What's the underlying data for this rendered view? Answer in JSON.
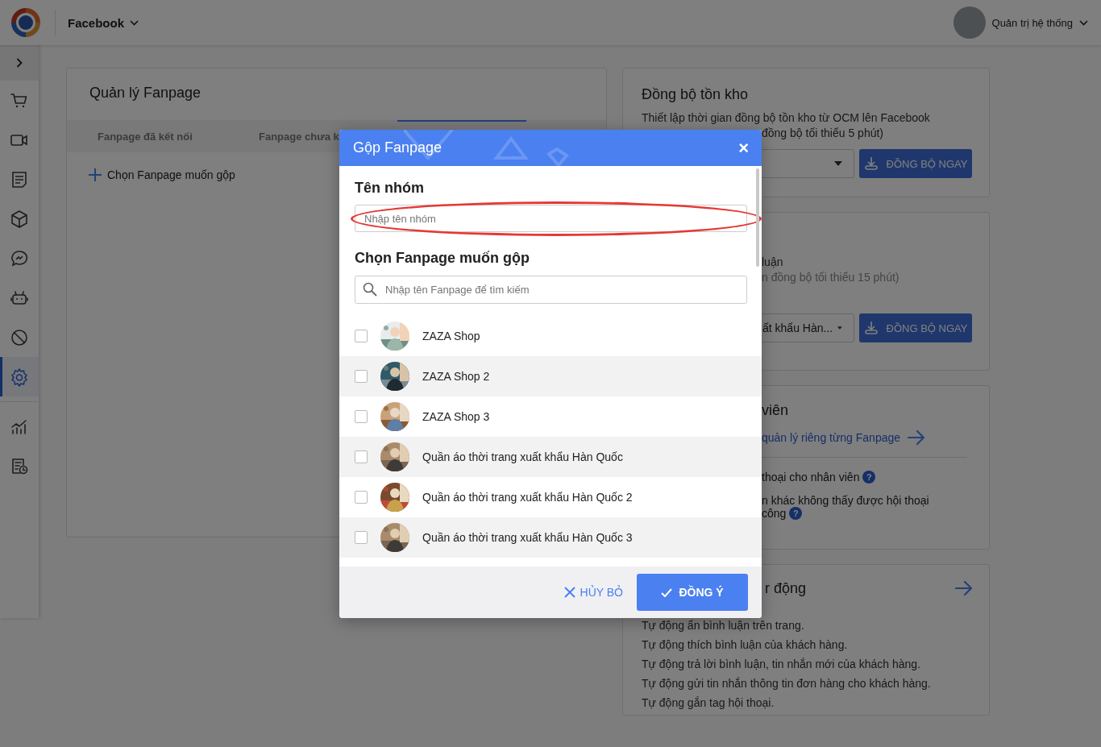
{
  "header": {
    "app": "Facebook",
    "user": "Quản trị hệ thống"
  },
  "sidebar": {
    "items": [
      {
        "kind": "cart",
        "selected": false
      },
      {
        "kind": "video",
        "selected": false
      },
      {
        "kind": "document",
        "selected": false
      },
      {
        "kind": "box",
        "selected": false
      },
      {
        "kind": "chat",
        "selected": false
      },
      {
        "kind": "robot",
        "selected": false
      },
      {
        "kind": "block",
        "selected": false
      },
      {
        "kind": "settings",
        "selected": true
      },
      {
        "kind": "chart",
        "selected": false
      },
      {
        "kind": "report",
        "selected": false
      }
    ]
  },
  "fanpage_panel": {
    "title": "Quản lý Fanpage",
    "tabs": [
      {
        "label": "Fanpage đã kết nối",
        "selected": false
      },
      {
        "label": "Fanpage chưa k",
        "selected": false
      }
    ],
    "add_label": "Chọn Fanpage muốn gộp"
  },
  "inventory_sync": {
    "title": "Đồng bộ tồn kho",
    "lines": [
      "Thiết lập thời gian đồng bộ tồn kho từ OCM lên Facebook",
      "đồng bộ tối thiểu 5 phút)"
    ],
    "button": "ĐỒNG BỘ NGAY"
  },
  "comment_sync": {
    "lines": [
      "luận",
      "n đồng bộ tối thiểu 15 phút)"
    ],
    "select_value": "ất khẩu Hàn...",
    "button": "ĐỒNG BỘ NGAY"
  },
  "staff": {
    "title": "viên",
    "link": "quản lý riêng từng Fanpage",
    "lines": [
      {
        "text": "thoại cho nhân viên",
        "hint": "?"
      },
      {
        "text": "n khác không thấy được hội thoại"
      },
      {
        "text": "công",
        "hint": "?"
      }
    ]
  },
  "automation": {
    "title": "r động",
    "lines": [
      "Tự động ẩn bình luận trên trang.",
      "Tự động thích bình luận của khách hàng.",
      "Tự động trả lời bình luận, tin nhắn mới của khách hàng.",
      "Tự động gửi tin nhắn thông tin đơn hàng cho khách hàng.",
      "Tự động gắn tag hội thoại."
    ]
  },
  "dialog": {
    "title": "Gộp Fanpage",
    "close": "×",
    "name_label": "Tên nhóm",
    "name_placeholder": "Nhập tên nhóm",
    "pick_label": "Chọn Fanpage muốn gộp",
    "search_placeholder": "Nhập tên Fanpage để tìm kiếm",
    "fanpages": [
      {
        "name": "ZAZA Shop",
        "checked": false
      },
      {
        "name": "ZAZA Shop 2",
        "checked": false
      },
      {
        "name": "ZAZA Shop 3",
        "checked": false
      },
      {
        "name": "Quần áo thời trang xuất khẩu Hàn Quốc",
        "checked": false
      },
      {
        "name": "Quần áo thời trang xuất khẩu Hàn Quốc 2",
        "checked": false
      },
      {
        "name": "Quần áo thời trang xuất khẩu Hàn Quốc 3",
        "checked": false
      }
    ],
    "cancel": "HỦY BỎ",
    "confirm": "ĐỒNG Ý"
  }
}
